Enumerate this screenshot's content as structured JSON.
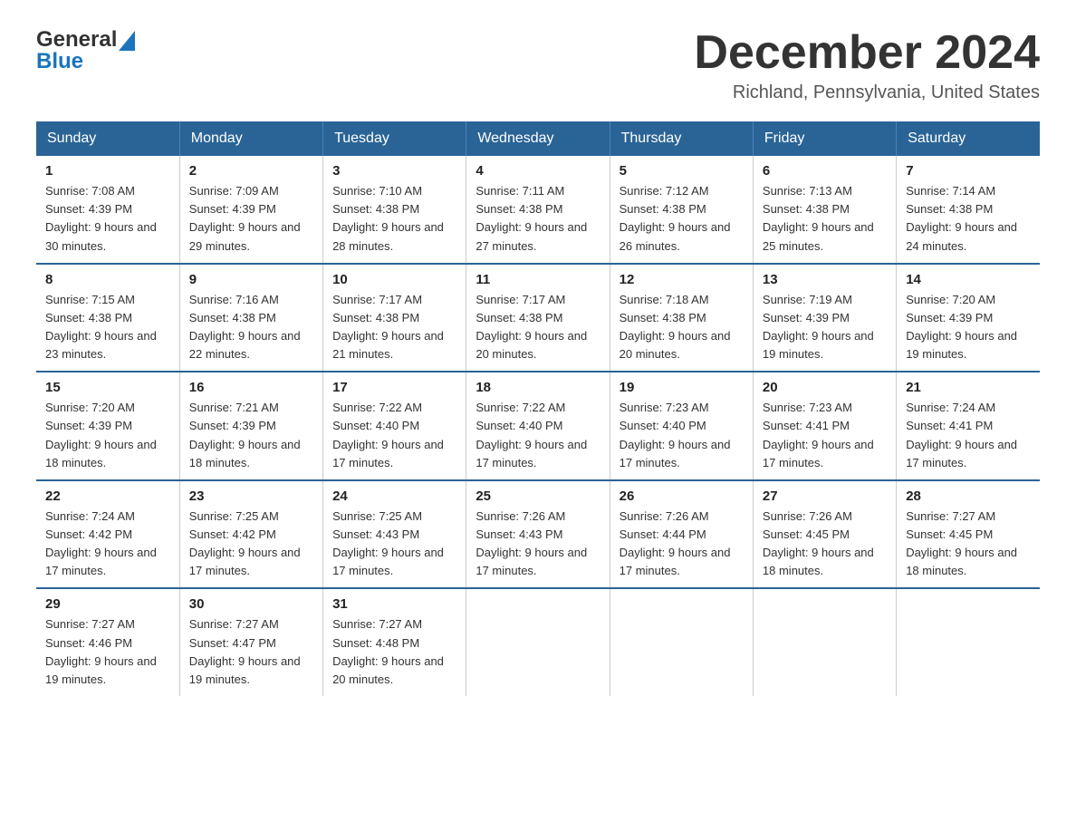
{
  "header": {
    "logo_line1": "General",
    "logo_line2": "Blue",
    "month_title": "December 2024",
    "location": "Richland, Pennsylvania, United States"
  },
  "days_of_week": [
    "Sunday",
    "Monday",
    "Tuesday",
    "Wednesday",
    "Thursday",
    "Friday",
    "Saturday"
  ],
  "weeks": [
    [
      {
        "day": 1,
        "sunrise": "7:08 AM",
        "sunset": "4:39 PM",
        "daylight": "9 hours and 30 minutes."
      },
      {
        "day": 2,
        "sunrise": "7:09 AM",
        "sunset": "4:39 PM",
        "daylight": "9 hours and 29 minutes."
      },
      {
        "day": 3,
        "sunrise": "7:10 AM",
        "sunset": "4:38 PM",
        "daylight": "9 hours and 28 minutes."
      },
      {
        "day": 4,
        "sunrise": "7:11 AM",
        "sunset": "4:38 PM",
        "daylight": "9 hours and 27 minutes."
      },
      {
        "day": 5,
        "sunrise": "7:12 AM",
        "sunset": "4:38 PM",
        "daylight": "9 hours and 26 minutes."
      },
      {
        "day": 6,
        "sunrise": "7:13 AM",
        "sunset": "4:38 PM",
        "daylight": "9 hours and 25 minutes."
      },
      {
        "day": 7,
        "sunrise": "7:14 AM",
        "sunset": "4:38 PM",
        "daylight": "9 hours and 24 minutes."
      }
    ],
    [
      {
        "day": 8,
        "sunrise": "7:15 AM",
        "sunset": "4:38 PM",
        "daylight": "9 hours and 23 minutes."
      },
      {
        "day": 9,
        "sunrise": "7:16 AM",
        "sunset": "4:38 PM",
        "daylight": "9 hours and 22 minutes."
      },
      {
        "day": 10,
        "sunrise": "7:17 AM",
        "sunset": "4:38 PM",
        "daylight": "9 hours and 21 minutes."
      },
      {
        "day": 11,
        "sunrise": "7:17 AM",
        "sunset": "4:38 PM",
        "daylight": "9 hours and 20 minutes."
      },
      {
        "day": 12,
        "sunrise": "7:18 AM",
        "sunset": "4:38 PM",
        "daylight": "9 hours and 20 minutes."
      },
      {
        "day": 13,
        "sunrise": "7:19 AM",
        "sunset": "4:39 PM",
        "daylight": "9 hours and 19 minutes."
      },
      {
        "day": 14,
        "sunrise": "7:20 AM",
        "sunset": "4:39 PM",
        "daylight": "9 hours and 19 minutes."
      }
    ],
    [
      {
        "day": 15,
        "sunrise": "7:20 AM",
        "sunset": "4:39 PM",
        "daylight": "9 hours and 18 minutes."
      },
      {
        "day": 16,
        "sunrise": "7:21 AM",
        "sunset": "4:39 PM",
        "daylight": "9 hours and 18 minutes."
      },
      {
        "day": 17,
        "sunrise": "7:22 AM",
        "sunset": "4:40 PM",
        "daylight": "9 hours and 17 minutes."
      },
      {
        "day": 18,
        "sunrise": "7:22 AM",
        "sunset": "4:40 PM",
        "daylight": "9 hours and 17 minutes."
      },
      {
        "day": 19,
        "sunrise": "7:23 AM",
        "sunset": "4:40 PM",
        "daylight": "9 hours and 17 minutes."
      },
      {
        "day": 20,
        "sunrise": "7:23 AM",
        "sunset": "4:41 PM",
        "daylight": "9 hours and 17 minutes."
      },
      {
        "day": 21,
        "sunrise": "7:24 AM",
        "sunset": "4:41 PM",
        "daylight": "9 hours and 17 minutes."
      }
    ],
    [
      {
        "day": 22,
        "sunrise": "7:24 AM",
        "sunset": "4:42 PM",
        "daylight": "9 hours and 17 minutes."
      },
      {
        "day": 23,
        "sunrise": "7:25 AM",
        "sunset": "4:42 PM",
        "daylight": "9 hours and 17 minutes."
      },
      {
        "day": 24,
        "sunrise": "7:25 AM",
        "sunset": "4:43 PM",
        "daylight": "9 hours and 17 minutes."
      },
      {
        "day": 25,
        "sunrise": "7:26 AM",
        "sunset": "4:43 PM",
        "daylight": "9 hours and 17 minutes."
      },
      {
        "day": 26,
        "sunrise": "7:26 AM",
        "sunset": "4:44 PM",
        "daylight": "9 hours and 17 minutes."
      },
      {
        "day": 27,
        "sunrise": "7:26 AM",
        "sunset": "4:45 PM",
        "daylight": "9 hours and 18 minutes."
      },
      {
        "day": 28,
        "sunrise": "7:27 AM",
        "sunset": "4:45 PM",
        "daylight": "9 hours and 18 minutes."
      }
    ],
    [
      {
        "day": 29,
        "sunrise": "7:27 AM",
        "sunset": "4:46 PM",
        "daylight": "9 hours and 19 minutes."
      },
      {
        "day": 30,
        "sunrise": "7:27 AM",
        "sunset": "4:47 PM",
        "daylight": "9 hours and 19 minutes."
      },
      {
        "day": 31,
        "sunrise": "7:27 AM",
        "sunset": "4:48 PM",
        "daylight": "9 hours and 20 minutes."
      },
      null,
      null,
      null,
      null
    ]
  ]
}
